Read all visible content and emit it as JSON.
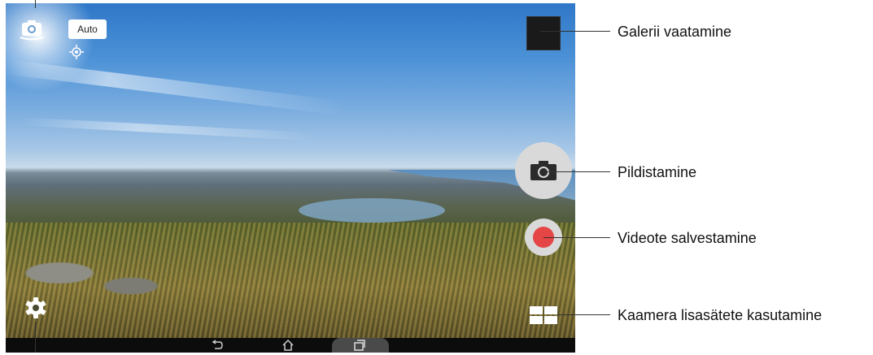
{
  "camera": {
    "mode_chip": "Auto"
  },
  "callouts": {
    "gallery": "Galerii vaatamine",
    "photo": "Pildistamine",
    "video": "Videote salvestamine",
    "extras": "Kaamera lisasätete kasutamine"
  },
  "icons": {
    "camera_switch": "camera-switch-icon",
    "focus": "focus-target-icon",
    "shutter": "camera-icon",
    "record": "record-icon",
    "extras": "grid-icon",
    "settings": "gear-icon",
    "back": "back-icon",
    "home": "home-icon",
    "recents": "recents-icon"
  },
  "colors": {
    "record_red": "#e54545",
    "button_grey": "#d9d9d9"
  }
}
